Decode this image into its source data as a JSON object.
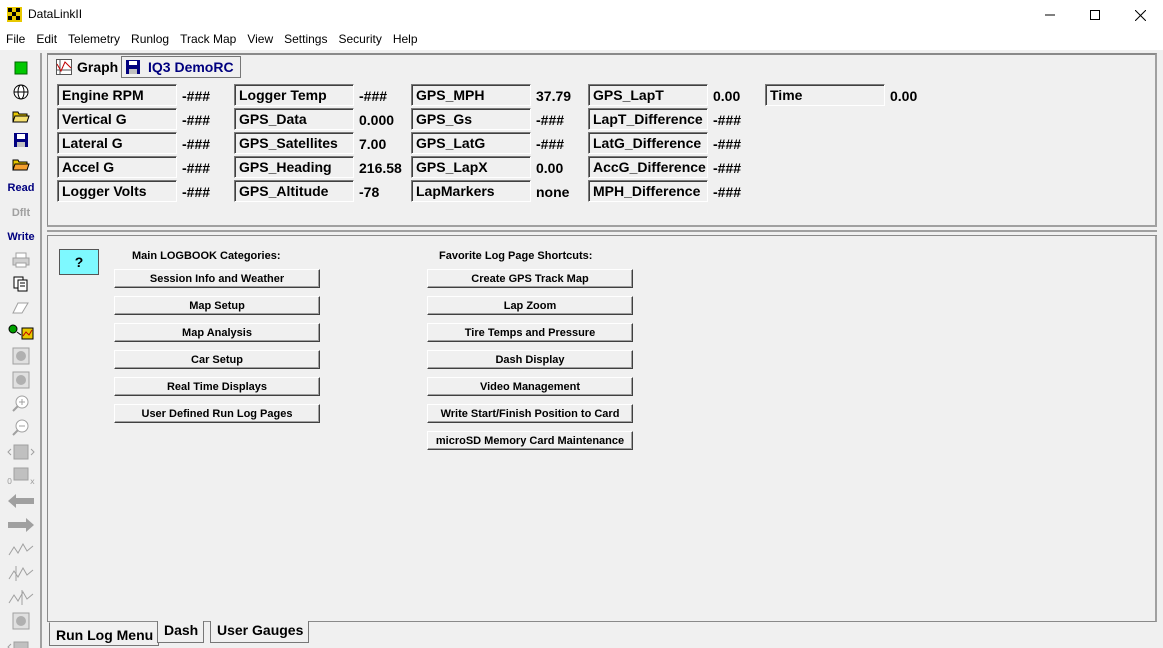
{
  "window": {
    "title": "DataLinkII"
  },
  "menu": [
    "File",
    "Edit",
    "Telemetry",
    "Runlog",
    "Track Map",
    "View",
    "Settings",
    "Security",
    "Help"
  ],
  "toolbar": {
    "read_label": "Read",
    "dflt_label": "Dflt",
    "write_label": "Write"
  },
  "tabs": {
    "graph": "Graph",
    "iq3": "IQ3 DemoRC"
  },
  "channels": [
    [
      {
        "label": "Engine RPM",
        "value": "-###"
      },
      {
        "label": "Vertical G",
        "value": "-###"
      },
      {
        "label": "Lateral G",
        "value": "-###"
      },
      {
        "label": "Accel G",
        "value": "-###"
      },
      {
        "label": "Logger Volts",
        "value": "-###"
      }
    ],
    [
      {
        "label": "Logger Temp",
        "value": "-###"
      },
      {
        "label": "GPS_Data",
        "value": "0.000"
      },
      {
        "label": "GPS_Satellites",
        "value": "7.00"
      },
      {
        "label": "GPS_Heading",
        "value": "216.58"
      },
      {
        "label": "GPS_Altitude",
        "value": "-78"
      }
    ],
    [
      {
        "label": "GPS_MPH",
        "value": "37.79"
      },
      {
        "label": "GPS_Gs",
        "value": "-###"
      },
      {
        "label": "GPS_LatG",
        "value": "-###"
      },
      {
        "label": "GPS_LapX",
        "value": "0.00"
      },
      {
        "label": "LapMarkers",
        "value": "none"
      }
    ],
    [
      {
        "label": "GPS_LapT",
        "value": "0.00"
      },
      {
        "label": "LapT_Difference",
        "value": "-###"
      },
      {
        "label": "LatG_Difference",
        "value": "-###"
      },
      {
        "label": "AccG_Difference",
        "value": "-###"
      },
      {
        "label": "MPH_Difference",
        "value": "-###"
      }
    ],
    [
      {
        "label": "Time",
        "value": "0.00"
      }
    ]
  ],
  "help_button": "?",
  "logbook": {
    "heading": "Main LOGBOOK Categories:",
    "buttons": [
      "Session Info and Weather",
      "Map Setup",
      "Map Analysis",
      "Car Setup",
      "Real Time Displays",
      "User Defined Run Log Pages"
    ]
  },
  "shortcuts": {
    "heading": "Favorite Log Page Shortcuts:",
    "buttons": [
      "Create GPS Track Map",
      "Lap Zoom",
      "Tire Temps and Pressure",
      "Dash Display",
      "Video Management",
      "Write Start/Finish Position to Card",
      "microSD Memory Card Maintenance"
    ]
  },
  "bottom_tabs": {
    "runlog": "Run Log Menu",
    "dash": "Dash",
    "gauges": "User Gauges"
  }
}
